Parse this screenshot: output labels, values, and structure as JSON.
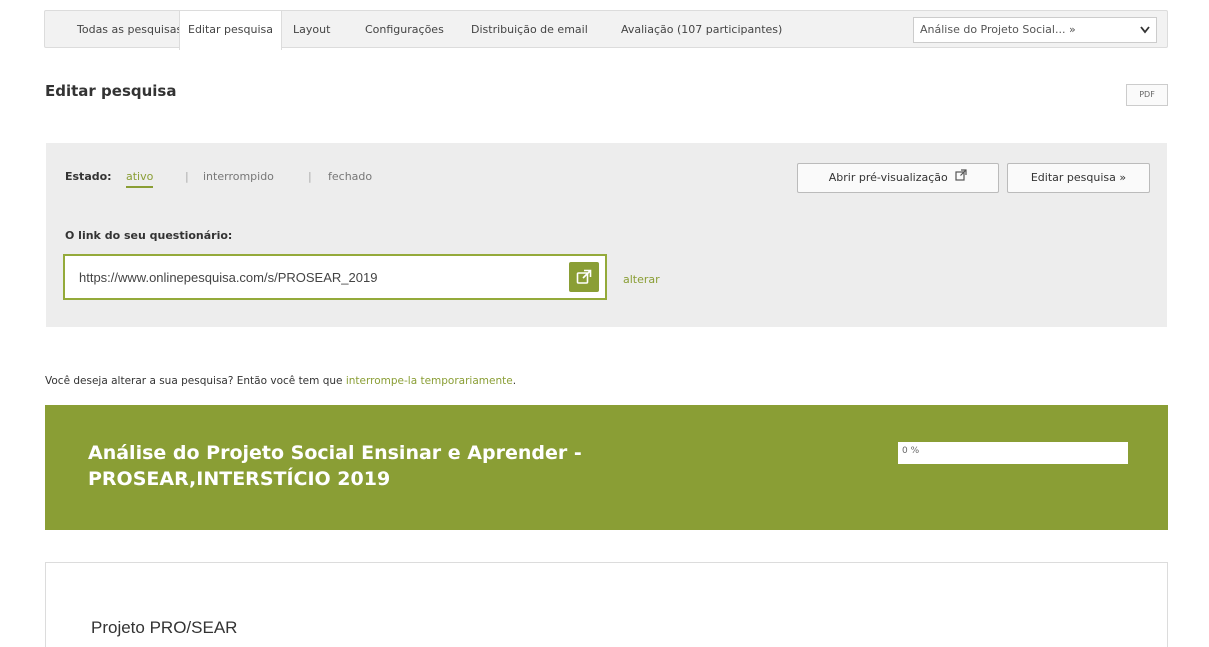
{
  "nav": {
    "tabs": [
      {
        "label": "Todas as pesquisas"
      },
      {
        "label": "Editar pesquisa",
        "active": true
      },
      {
        "label": "Layout"
      },
      {
        "label": "Configurações"
      },
      {
        "label": "Distribuição de email"
      },
      {
        "label": "Avaliação (107 participantes)"
      }
    ],
    "survey_select": {
      "value": "Análise do Projeto Social... »"
    }
  },
  "header": {
    "title": "Editar pesquisa",
    "pdf_label": "PDF"
  },
  "status_panel": {
    "state_label": "Estado:",
    "states": [
      "ativo",
      "interrompido",
      "fechado"
    ],
    "active_state": "ativo",
    "separator": "|",
    "preview_button": "Abrir pré-visualização",
    "edit_button": "Editar pesquisa »",
    "link_label": "O link do seu questionário:",
    "link_url": "https://www.onlinepesquisa.com/s/PROSEAR_2019",
    "change_link": "alterar"
  },
  "notice": {
    "text": "Você deseja alterar a sua pesquisa? Então você tem que ",
    "link": "interrompe-la temporariamente",
    "suffix": "."
  },
  "survey": {
    "title_line1": "Análise do Projeto Social Ensinar e Aprender -",
    "title_line2": "PROSEAR,INTERSTÍCIO 2019",
    "progress_percent": 0,
    "progress_text": "0 %",
    "section_title": "Projeto PRO/SEAR"
  },
  "colors": {
    "accent": "#8a9e35",
    "panel_bg": "#ededed"
  },
  "icons": {
    "external_link": "external-link-icon",
    "dropdown": "chevron-down-icon"
  }
}
